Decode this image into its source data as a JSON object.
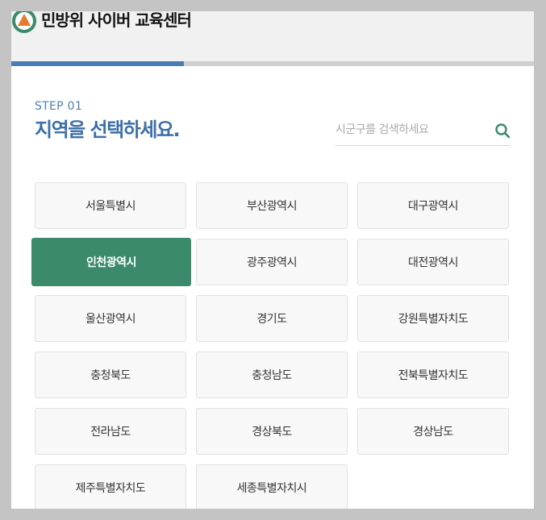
{
  "header": {
    "brand": "민방위 사이버 교육센터",
    "logo_icon": "civil-defense-emblem-icon"
  },
  "progress": {
    "fraction": 0.33
  },
  "step": {
    "label": "STEP 01",
    "title": "지역을 선택하세요."
  },
  "search": {
    "placeholder": "시군구를 검색하세요",
    "value": "",
    "icon": "search-icon"
  },
  "colors": {
    "accent_blue": "#4a7db4",
    "selected_green": "#3b8a69",
    "logo_green": "#3b8a69",
    "logo_orange": "#e8792e"
  },
  "regions": [
    {
      "label": "서울특별시",
      "selected": false
    },
    {
      "label": "부산광역시",
      "selected": false
    },
    {
      "label": "대구광역시",
      "selected": false
    },
    {
      "label": "인천광역시",
      "selected": true
    },
    {
      "label": "광주광역시",
      "selected": false
    },
    {
      "label": "대전광역시",
      "selected": false
    },
    {
      "label": "울산광역시",
      "selected": false
    },
    {
      "label": "경기도",
      "selected": false
    },
    {
      "label": "강원특별자치도",
      "selected": false
    },
    {
      "label": "충청북도",
      "selected": false
    },
    {
      "label": "충청남도",
      "selected": false
    },
    {
      "label": "전북특별자치도",
      "selected": false
    },
    {
      "label": "전라남도",
      "selected": false
    },
    {
      "label": "경상북도",
      "selected": false
    },
    {
      "label": "경상남도",
      "selected": false
    },
    {
      "label": "제주특별자치도",
      "selected": false
    },
    {
      "label": "세종특별자치시",
      "selected": false
    }
  ]
}
